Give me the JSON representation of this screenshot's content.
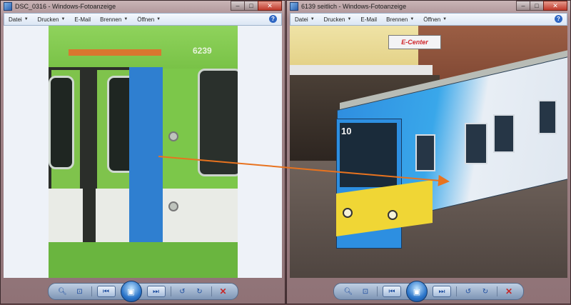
{
  "windows": [
    {
      "title": "DSC_0316 - Windows-Fotoanzeige",
      "menu": [
        {
          "label": "Datei",
          "has_dropdown": true
        },
        {
          "label": "Drucken",
          "has_dropdown": true
        },
        {
          "label": "E-Mail",
          "has_dropdown": false
        },
        {
          "label": "Brennen",
          "has_dropdown": true
        },
        {
          "label": "Öffnen",
          "has_dropdown": true
        }
      ],
      "photo_text": {
        "car_number": "6239"
      }
    },
    {
      "title": "6139 seitlich - Windows-Fotoanzeige",
      "menu": [
        {
          "label": "Datei",
          "has_dropdown": true
        },
        {
          "label": "Drucken",
          "has_dropdown": true
        },
        {
          "label": "E-Mail",
          "has_dropdown": false
        },
        {
          "label": "Brennen",
          "has_dropdown": true
        },
        {
          "label": "Öffnen",
          "has_dropdown": true
        }
      ],
      "photo_text": {
        "route_number": "10",
        "shop_sign": "E-Center"
      }
    }
  ],
  "icons": {
    "help": "help-icon",
    "zoom": "zoom-icon",
    "fit": "fit-to-window-icon",
    "prev": "previous-icon",
    "slideshow": "slideshow-icon",
    "next": "next-icon",
    "rotate_ccw": "rotate-counterclockwise-icon",
    "rotate_cw": "rotate-clockwise-icon",
    "delete": "delete-icon"
  },
  "colors": {
    "annotation_arrow": "#e8731f",
    "tram_green": "#7cc74a",
    "tram_blue": "#2f7fd0"
  }
}
